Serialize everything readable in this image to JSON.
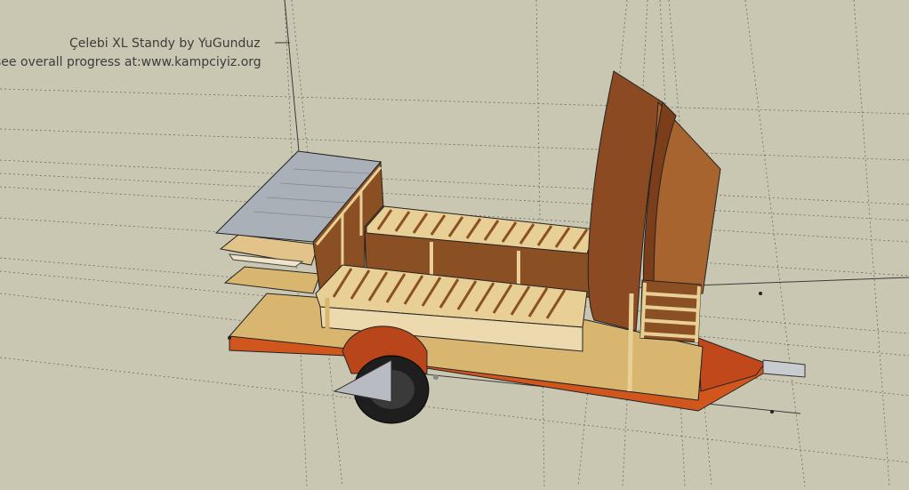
{
  "scene": {
    "title_label": "Çelebi XL Standy  by YuGunduz",
    "progress_label": "see overall progress at:www.kampciyiz.org",
    "colors": {
      "background": "#c9c7b2",
      "frame": "#d0561e",
      "plywood": "#d9b66f",
      "wood_dark": "#8a4f22",
      "wood_light": "#e8cf96",
      "metal_top": "#a9b0b8",
      "tire": "#1e1e1e",
      "guide_lines": "#5a5a5a"
    },
    "icons": [
      "trailer-model",
      "wheel-icon",
      "hitch-icon"
    ]
  }
}
